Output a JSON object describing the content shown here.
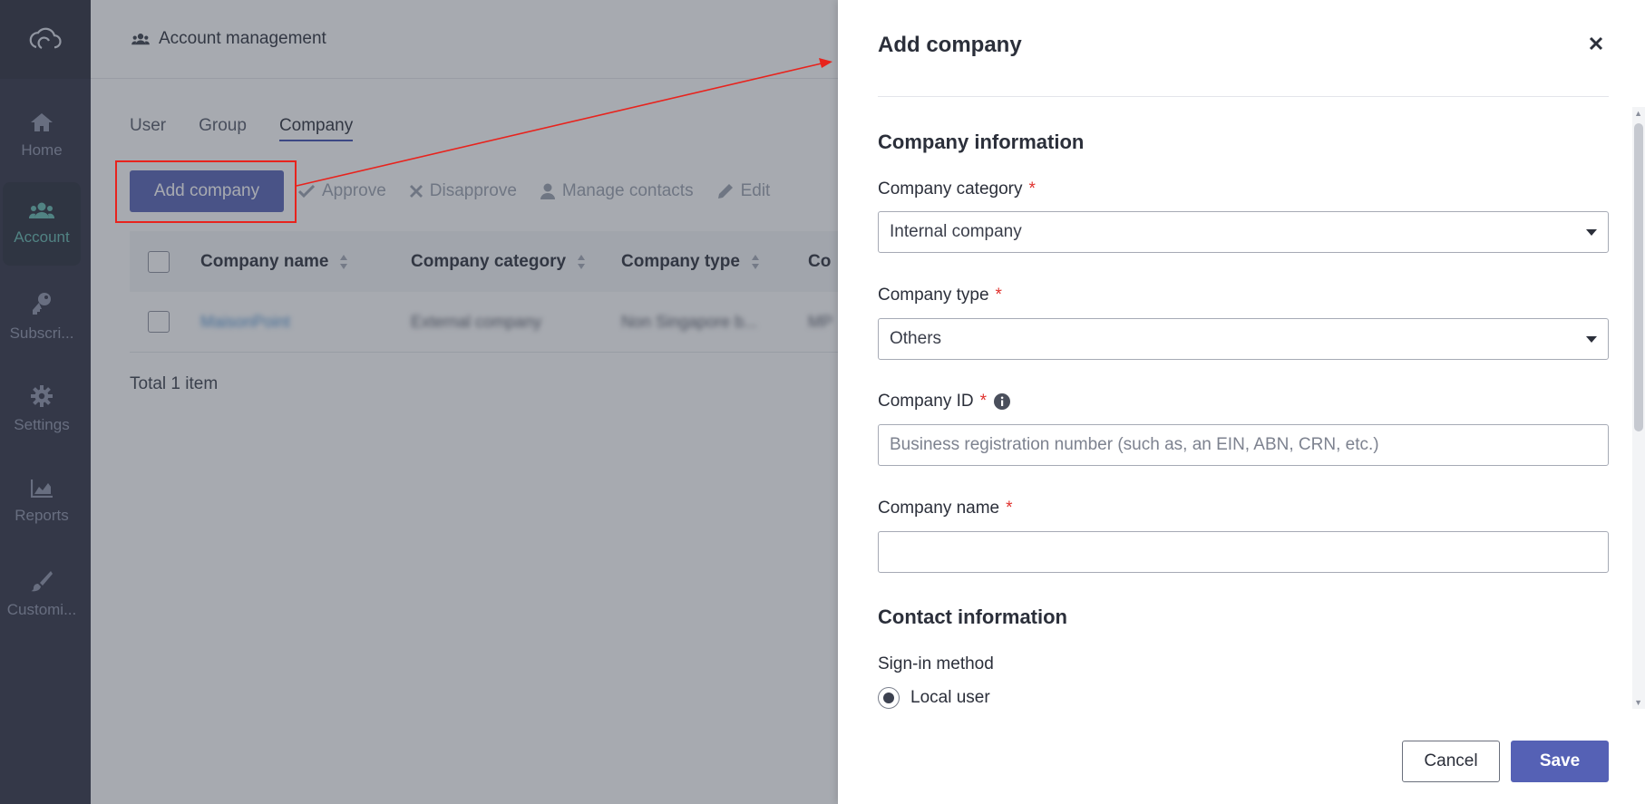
{
  "app": {
    "header_title": "Account management"
  },
  "sidebar": {
    "items": [
      {
        "label": "Home",
        "icon": "home-icon",
        "active": false
      },
      {
        "label": "Account",
        "icon": "users-icon",
        "active": true
      },
      {
        "label": "Subscri...",
        "icon": "key-icon",
        "active": false
      },
      {
        "label": "Settings",
        "icon": "gear-icon",
        "active": false
      },
      {
        "label": "Reports",
        "icon": "chart-icon",
        "active": false
      },
      {
        "label": "Customi...",
        "icon": "brush-icon",
        "active": false
      }
    ]
  },
  "tabs": [
    {
      "label": "User",
      "active": false
    },
    {
      "label": "Group",
      "active": false
    },
    {
      "label": "Company",
      "active": true
    }
  ],
  "toolbar": {
    "add_label": "Add company",
    "approve_label": "Approve",
    "disapprove_label": "Disapprove",
    "manage_contacts_label": "Manage contacts",
    "edit_label": "Edit"
  },
  "table": {
    "columns": [
      "Company name",
      "Company category",
      "Company type",
      "Co"
    ],
    "rows": [
      {
        "name": "MaisonPoint",
        "category": "External company",
        "type": "Non Singapore b...",
        "extra": "MP"
      }
    ],
    "total": "Total 1 item"
  },
  "drawer": {
    "title": "Add company",
    "section_company": "Company information",
    "category_label": "Company category",
    "category_value": "Internal company",
    "type_label": "Company type",
    "type_value": "Others",
    "id_label": "Company ID",
    "id_placeholder": "Business registration number (such as, an EIN, ABN, CRN, etc.)",
    "name_label": "Company name",
    "name_value": "",
    "section_contact": "Contact information",
    "signin_label": "Sign-in method",
    "signin_option": "Local user",
    "cancel_label": "Cancel",
    "save_label": "Save",
    "required_mark": "*"
  },
  "colors": {
    "sidebar_bg": "#2e3142",
    "accent_teal": "#63b8ae",
    "primary_button": "#5561b5",
    "annotation_red": "#e8231d"
  }
}
